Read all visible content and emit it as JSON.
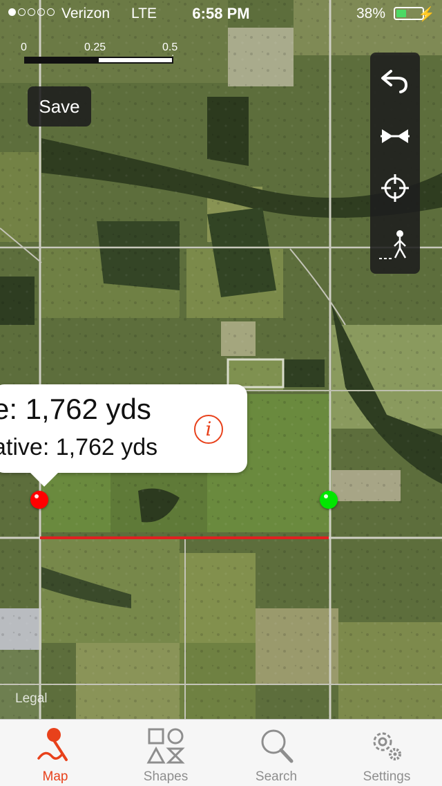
{
  "status_bar": {
    "carrier": "Verizon",
    "network": "LTE",
    "time": "6:58 PM",
    "battery_percent_label": "38%",
    "battery_level": 0.38,
    "signal_bars_filled": 1,
    "signal_bars_total": 5,
    "charging_icon": "bolt-icon"
  },
  "scale_bar": {
    "labels": [
      "0",
      "0.25",
      "0.5 mi"
    ]
  },
  "save_button": {
    "label": "Save"
  },
  "toolbar": {
    "items": [
      {
        "name": "undo",
        "icon": "undo-arrow-icon"
      },
      {
        "name": "collapse",
        "icon": "arrows-inward-icon"
      },
      {
        "name": "locate",
        "icon": "crosshair-icon"
      },
      {
        "name": "walk",
        "icon": "pedestrian-icon"
      }
    ]
  },
  "callout": {
    "distance_text": "e: 1,762 yds",
    "cumulative_text": "ative: 1,762 yds",
    "info_icon": "info-icon",
    "info_color": "#e8411b"
  },
  "markers": {
    "start_color": "#ff0000",
    "end_color": "#00e600",
    "line_color": "#e02020"
  },
  "legal_label": "Legal",
  "tabbar": {
    "active_color": "#e8411b",
    "tabs": [
      {
        "label": "Map",
        "icon": "map-pin-icon",
        "active": true
      },
      {
        "label": "Shapes",
        "icon": "shapes-icon",
        "active": false
      },
      {
        "label": "Search",
        "icon": "magnifier-icon",
        "active": false
      },
      {
        "label": "Settings",
        "icon": "gears-icon",
        "active": false
      }
    ]
  }
}
